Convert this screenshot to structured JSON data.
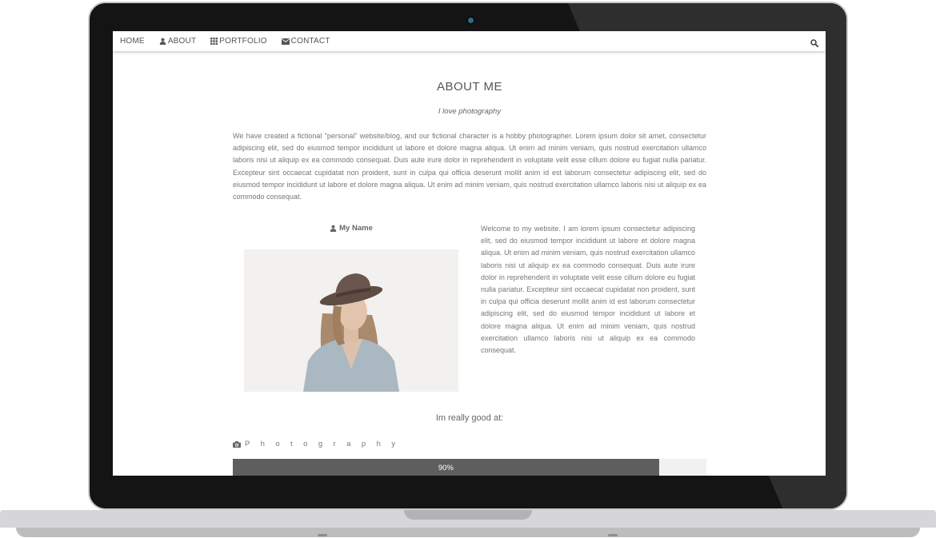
{
  "nav": {
    "home": "HOME",
    "about": "ABOUT",
    "portfolio": "PORTFOLIO",
    "contact": "CONTACT",
    "search_icon": "search-icon"
  },
  "about": {
    "title": "ABOUT ME",
    "subtitle": "I love photography",
    "intro": "We have created a fictional \"personal\" website/blog, and our fictional character is a hobby photographer. Lorem ipsum dolor sit amet, consectetur adipiscing elit, sed do eiusmod tempor incididunt ut labore et dolore magna aliqua. Ut enim ad minim veniam, quis nostrud exercitation ullamco laboris nisi ut aliquip ex ea commodo consequat. Duis aute irure dolor in reprehenderit in voluptate velit esse cillum dolore eu fugiat nulla pariatur. Excepteur sint occaecat cupidatat non proident, sunt in culpa qui officia deserunt mollit anim id est laborum consectetur adipiscing elit, sed do eiusmod tempor incididunt ut labore et dolore magna aliqua. Ut enim ad minim veniam, quis nostrud exercitation ullamco laboris nisi ut aliquip ex ea commodo consequat.",
    "name": "My Name",
    "bio": "Welcome to my website. I am lorem ipsum consectetur adipiscing elit, sed do eiusmod tempor incididunt ut labore et dolore magna aliqua. Ut enim ad minim veniam, quis nostrud exercitation ullamco laboris nisi ut aliquip ex ea commodo consequat. Duis aute irure dolor in reprehenderit in voluptate velit esse cillum dolore eu fugiat nulla pariatur. Excepteur sint occaecat cupidatat non proident, sunt in culpa qui officia deserunt mollit anim id est laborum consectetur adipiscing elit, sed do eiusmod tempor incididunt ut labore et dolore magna aliqua. Ut enim ad minim veniam, quis nostrud exercitation ullamco laboris nisi ut aliquip ex ea commodo consequat."
  },
  "skills": {
    "heading": "Im really good at:",
    "items": [
      {
        "name": "P h o t o g r a p h y",
        "icon": "camera-icon",
        "label": "90%",
        "fraction": 0.9
      }
    ]
  },
  "colors": {
    "bar_fill": "#5e5e5e",
    "bar_track": "#f1f1f1",
    "text": "#777777",
    "laptop_bezel": "#141414"
  }
}
